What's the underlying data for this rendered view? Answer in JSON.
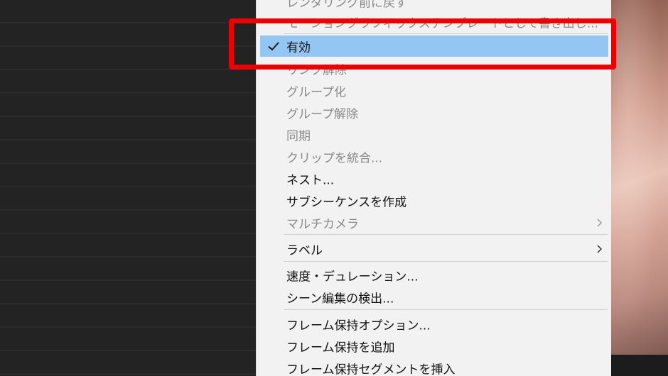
{
  "context_menu": {
    "items": [
      {
        "label": "レンダリング前に戻す",
        "enabled": false
      },
      {
        "label": "モーショングラフィックステンプレートとして書き出し...",
        "enabled": false
      },
      {
        "label": "有効",
        "enabled": true,
        "checked": true,
        "highlighted": true
      },
      {
        "label": "リンク解除",
        "enabled": false
      },
      {
        "label": "グループ化",
        "enabled": false
      },
      {
        "label": "グループ解除",
        "enabled": false
      },
      {
        "label": "同期",
        "enabled": false
      },
      {
        "label": "クリップを統合...",
        "enabled": false
      },
      {
        "label": "ネスト...",
        "enabled": true
      },
      {
        "label": "サブシーケンスを作成",
        "enabled": true
      },
      {
        "label": "マルチカメラ",
        "enabled": false,
        "has_submenu": true
      },
      {
        "label": "ラベル",
        "enabled": true,
        "has_submenu": true
      },
      {
        "label": "速度・デュレーション...",
        "enabled": true
      },
      {
        "label": "シーン編集の検出...",
        "enabled": true
      },
      {
        "label": "フレーム保持オプション...",
        "enabled": true
      },
      {
        "label": "フレーム保持を追加",
        "enabled": true
      },
      {
        "label": "フレーム保持セグメントを挿入",
        "enabled": true
      }
    ]
  },
  "colors": {
    "menu_background": "#f2f2f2",
    "highlight": "#94c6f3",
    "annotation": "#ee0000",
    "timeline_background": "#232323"
  },
  "icons": {
    "check": "check-icon",
    "submenu": "chevron-right-icon"
  }
}
